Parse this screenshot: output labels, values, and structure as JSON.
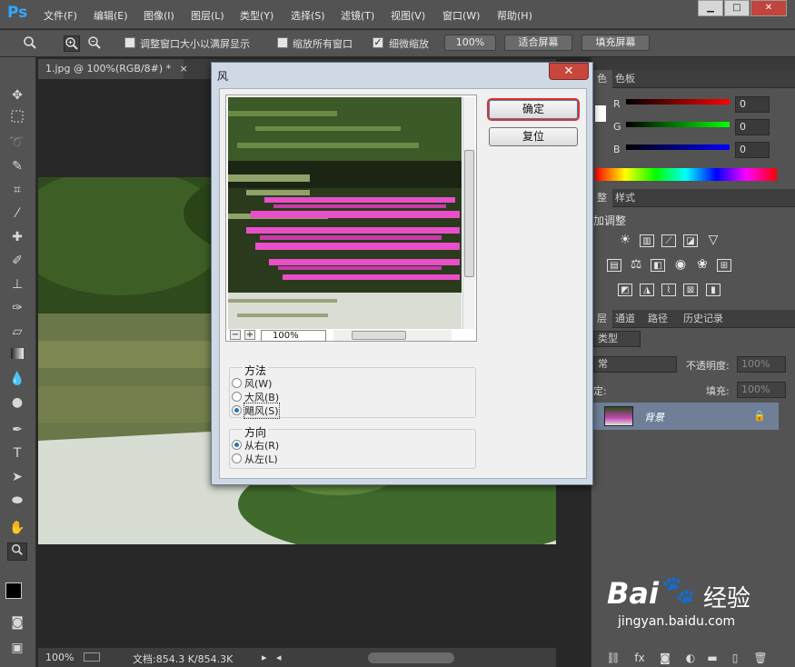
{
  "app": {
    "logo": "Ps"
  },
  "menu": [
    "文件(F)",
    "编辑(E)",
    "图像(I)",
    "图层(L)",
    "类型(Y)",
    "选择(S)",
    "滤镜(T)",
    "视图(V)",
    "窗口(W)",
    "帮助(H)"
  ],
  "window_controls": {
    "minimize": "▁",
    "maximize": "□",
    "close": "✕"
  },
  "options": {
    "resize_window_label": "调整窗口大小以满屏显示",
    "zoom_all_label": "缩放所有窗口",
    "scrubby_zoom_label": "细微缩放",
    "scrubby_zoom_checked": true,
    "zoom_100_label": "100%",
    "fit_screen_label": "适合屏幕",
    "fill_screen_label": "填充屏幕"
  },
  "document": {
    "tab_label": "1.jpg @ 100%(RGB/8#) *",
    "tab_close": "×"
  },
  "statusbar": {
    "zoom": "100%",
    "doc_info": "文档:854.3 K/854.3K"
  },
  "dialog": {
    "title": "风",
    "close": "✕",
    "ok_label": "确定",
    "reset_label": "复位",
    "zoom_value": "100%",
    "zoom_minus": "−",
    "zoom_plus": "+",
    "method_label": "方法",
    "methods": [
      {
        "label": "风(W)",
        "selected": false
      },
      {
        "label": "大风(B)",
        "selected": false
      },
      {
        "label": "飓风(S)",
        "selected": true
      }
    ],
    "direction_label": "方向",
    "directions": [
      {
        "label": "从右(R)",
        "selected": true
      },
      {
        "label": "从左(L)",
        "selected": false
      }
    ]
  },
  "color_panel": {
    "tabs": [
      "色",
      "色板"
    ],
    "channels": [
      {
        "label": "R",
        "value": "0",
        "color": "#ff0000"
      },
      {
        "label": "G",
        "value": "0",
        "color": "#00ff00"
      },
      {
        "label": "B",
        "value": "0",
        "color": "#0000ff"
      }
    ]
  },
  "adjustments_panel": {
    "tabs": [
      "整",
      "样式"
    ],
    "heading": "加调整"
  },
  "layers_panel": {
    "tabs": [
      "层",
      "通道",
      "路径",
      "历史记录"
    ],
    "kind_label": "类型",
    "blend_label": "常",
    "opacity_label": "不透明度:",
    "opacity_value": "100%",
    "lock_label": "定:",
    "fill_label": "填充:",
    "fill_value": "100%",
    "layer_name": "背景"
  },
  "watermark": {
    "brand": "Bai",
    "brand2": "经验",
    "url": "jingyan.baidu.com"
  },
  "colors": {
    "accent_highlight": "#e03030",
    "layer_selected": "#6f7f98",
    "dialog_close": "#c9463d"
  }
}
